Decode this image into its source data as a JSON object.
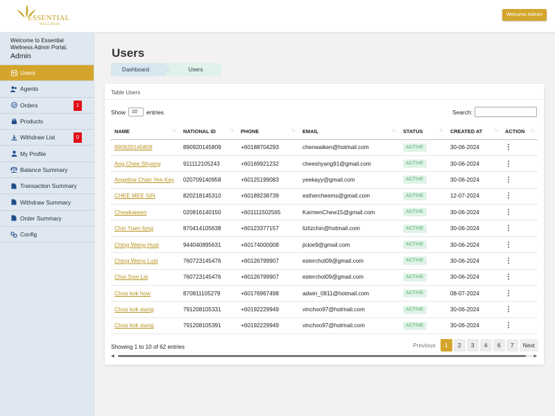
{
  "brand": {
    "name": "ESSENTIAL",
    "sub": "WELLNESS",
    "accent": "#d4a52c"
  },
  "header": {
    "welcome_button": "Welcome Admin!"
  },
  "sidebar": {
    "welcome_line": "Welcome to Essential Wellness Admin Portal,",
    "user": "Admin",
    "items": [
      {
        "label": "Users",
        "icon": "users-icon",
        "active": true
      },
      {
        "label": "Agents",
        "icon": "agents-icon"
      },
      {
        "label": "Orders",
        "icon": "orders-icon",
        "badge": "1"
      },
      {
        "label": "Products",
        "icon": "products-icon"
      },
      {
        "label": "Withdraw List",
        "icon": "withdraw-icon",
        "badge": "0"
      },
      {
        "label": "My Profile",
        "icon": "profile-icon"
      },
      {
        "label": "Balance Summary",
        "icon": "balance-icon"
      },
      {
        "label": "Transaction Summary",
        "icon": "document-icon"
      },
      {
        "label": "Withdraw Summary",
        "icon": "document-icon"
      },
      {
        "label": "Order Summary",
        "icon": "document-icon"
      },
      {
        "label": "Config",
        "icon": "config-icon"
      }
    ]
  },
  "page": {
    "title": "Users",
    "breadcrumb": [
      "Dashboard",
      "Users"
    ]
  },
  "card": {
    "title": "Table Users",
    "show_label": "Show",
    "entries_label": "entries",
    "page_length": "10",
    "search_label": "Search:",
    "search_value": ""
  },
  "table": {
    "columns": [
      "NAME",
      "NATIONAL ID",
      "PHONE",
      "EMAIL",
      "STATUS",
      "CREATED AT",
      "ACTION"
    ],
    "rows": [
      {
        "name": "890920145809",
        "national_id": "890920145809",
        "phone": "+60188704293",
        "email": "chenwaiken@hotmail.com",
        "status": "ACTIVE",
        "created": "30-06-2024"
      },
      {
        "name": "Ang Chee Shyang",
        "national_id": "911112105243",
        "phone": "+60169921232",
        "email": "cheeshyang91@gmail.com",
        "status": "ACTIVE",
        "created": "30-06-2024"
      },
      {
        "name": "Angeline Chan Yee Kay",
        "national_id": "020709140958",
        "phone": "+60125199083",
        "email": "yeekayy@gmail.com",
        "status": "ACTIVE",
        "created": "30-06-2024"
      },
      {
        "name": "CHEE MEE SIN",
        "national_id": "820218145310",
        "phone": "+60189238739",
        "email": "esthercheems@gmail.com",
        "status": "ACTIVE",
        "created": "12-07-2024"
      },
      {
        "name": "Chewkaiwen",
        "national_id": "020816140150",
        "phone": "+601111502565",
        "email": "KarmenChew15@gmail.com",
        "status": "ACTIVE",
        "created": "30-06-2024"
      },
      {
        "name": "Chin Yuen fong",
        "national_id": "870414105638",
        "phone": "+60123377157",
        "email": "lizlizchin@hotmail.com",
        "status": "ACTIVE",
        "created": "30-06-2024"
      },
      {
        "name": "Ching Weng Hust",
        "national_id": "944040895631",
        "phone": "+60174000008",
        "email": "jickie9@gmail.com",
        "status": "ACTIVE",
        "created": "30-06-2024"
      },
      {
        "name": "Ching Weng Lust",
        "national_id": "760723145476",
        "phone": "+60126799907",
        "email": "esterchol09@gmail.com",
        "status": "ACTIVE",
        "created": "30-06-2024"
      },
      {
        "name": "Choi Sow Lai",
        "national_id": "760723145476",
        "phone": "+60126799907",
        "email": "esterchol09@gmail.com",
        "status": "ACTIVE",
        "created": "30-06-2024"
      },
      {
        "name": "Choo kok how",
        "national_id": "870811105279",
        "phone": "+60176967498",
        "email": "adwin_0811@hotmail.com",
        "status": "ACTIVE",
        "created": "08-07-2024"
      },
      {
        "name": "Choo kok siang",
        "national_id": "791208105331",
        "phone": "+60192229949",
        "email": "vinchoo97@hotmail.com",
        "status": "ACTIVE",
        "created": "30-06-2024"
      },
      {
        "name": "Choo kok siang",
        "national_id": "791208105391",
        "phone": "+60192229949",
        "email": "vinchoo97@hotmail.com",
        "status": "ACTIVE",
        "created": "30-06-2024"
      }
    ]
  },
  "footer": {
    "showing": "Showing 1 to 10 of 62 entries",
    "previous": "Previous",
    "next": "Next",
    "pages": [
      "1",
      "2",
      "3",
      "4",
      "6",
      "7"
    ],
    "current_page": "1"
  }
}
